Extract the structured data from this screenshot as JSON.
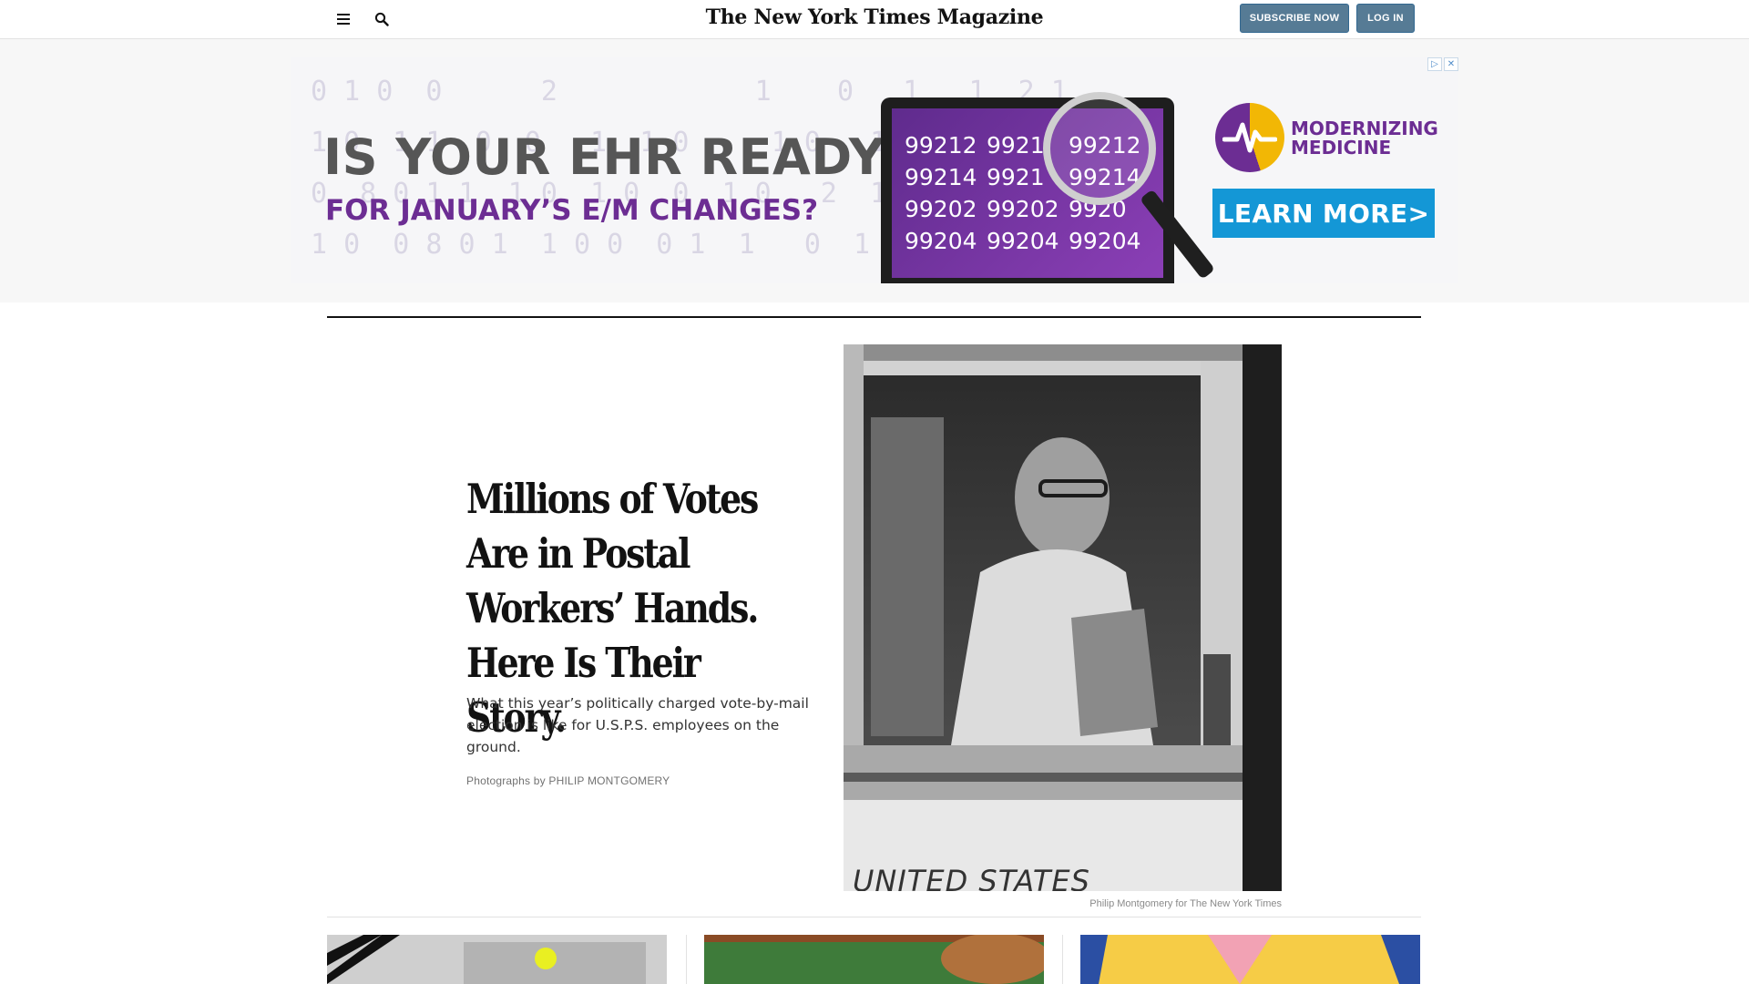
{
  "header": {
    "masthead": "The New York Times Magazine",
    "subscribe_label": "SUBSCRIBE NOW",
    "login_label": "LOG IN"
  },
  "ad": {
    "headline": "IS YOUR EHR READY",
    "subheadline": "FOR JANUARY’S E/M CHANGES?",
    "codes": [
      "99212",
      "9921",
      "99212",
      "99214",
      "9921",
      "99214",
      "99202",
      "99202",
      "9920",
      "99204",
      "99204",
      "99204"
    ],
    "brand": "MODERNIZING\nMEDICINE",
    "cta": "LEARN MORE>",
    "colors": {
      "purple": "#6c2d93",
      "blue": "#1497d6",
      "gold": "#f2b705"
    }
  },
  "story": {
    "headline": "Millions of Votes Are in Postal Workers’ Hands. Here Is Their Story.",
    "summary": "What this year’s politically charged vote-by-mail election is like for U.S.P.S. employees on the ground.",
    "byline_prefix": "Photographs by",
    "byline_name": "PHILIP MONTGOMERY",
    "photo_text": "UNITED STATES",
    "photo_credit": "Philip Montgomery for The New York Times"
  },
  "colors": {
    "button_bg": "#567b95",
    "rule": "#121212"
  }
}
